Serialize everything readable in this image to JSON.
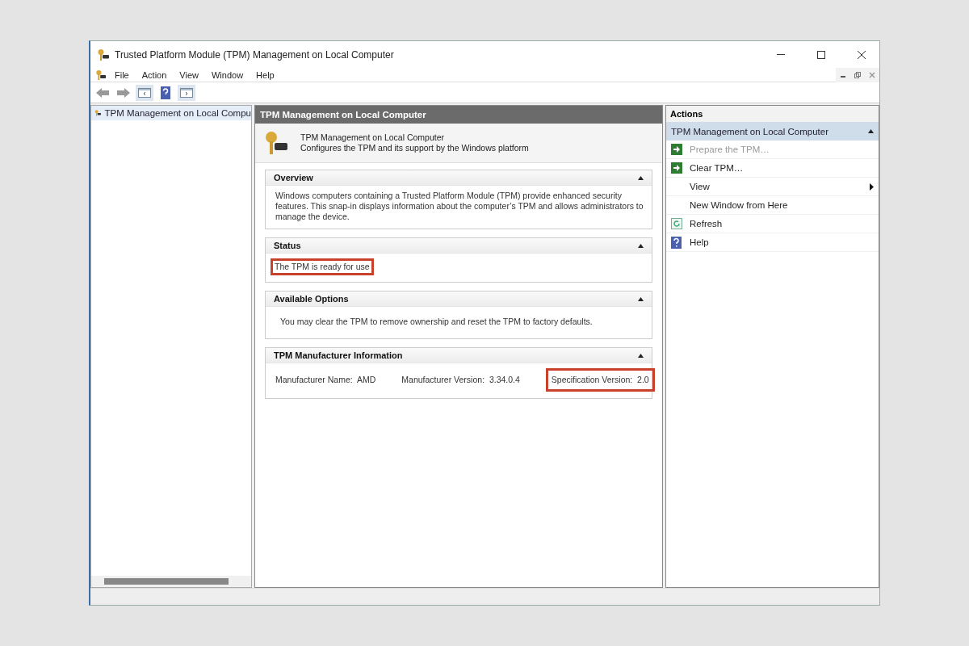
{
  "window": {
    "title": "Trusted Platform Module (TPM) Management on Local Computer"
  },
  "menu": [
    "File",
    "Action",
    "View",
    "Window",
    "Help"
  ],
  "tree": {
    "items": [
      {
        "label": "TPM Management on Local Compu",
        "selected": true
      }
    ]
  },
  "center": {
    "header": "TPM Management on Local Computer",
    "snapin": {
      "title": "TPM Management on Local Computer",
      "description": "Configures the TPM and its support by the Windows platform"
    },
    "sections": [
      {
        "title": "Overview",
        "expanded": true,
        "kind": "text",
        "text": "Windows computers containing a Trusted Platform Module (TPM) provide enhanced security features. This snap-in displays information about the computer’s TPM and allows administrators to manage the device.",
        "highlighted": false
      },
      {
        "title": "Status",
        "expanded": true,
        "kind": "text",
        "text": "The TPM is ready for use",
        "highlighted": true
      },
      {
        "title": "Available Options",
        "expanded": true,
        "kind": "indented",
        "text": "You may clear the TPM to remove ownership and reset the TPM to factory defaults.",
        "highlighted": false
      },
      {
        "title": "TPM Manufacturer Information",
        "expanded": true,
        "kind": "fields",
        "fields": [
          {
            "label": "Manufacturer Name:",
            "value": "AMD",
            "highlighted": false
          },
          {
            "label": "Manufacturer Version:",
            "value": "3.34.0.4",
            "highlighted": false
          },
          {
            "label": "Specification Version:",
            "value": "2.0",
            "highlighted": true
          }
        ]
      }
    ]
  },
  "actions": {
    "title": "Actions",
    "group": {
      "label": "TPM Management on Local Computer",
      "expanded": true
    },
    "items": [
      {
        "label": "Prepare the TPM…",
        "kind": "green-arrow",
        "disabled": true,
        "submenu": false
      },
      {
        "label": "Clear TPM…",
        "kind": "green-arrow",
        "disabled": false,
        "submenu": false
      },
      {
        "label": "View",
        "kind": "plain",
        "disabled": false,
        "submenu": true
      },
      {
        "label": "New Window from Here",
        "kind": "plain",
        "disabled": false,
        "submenu": false
      },
      {
        "label": "Refresh",
        "kind": "refresh",
        "disabled": false,
        "submenu": false
      },
      {
        "label": "Help",
        "kind": "help",
        "disabled": false,
        "submenu": false
      }
    ]
  }
}
